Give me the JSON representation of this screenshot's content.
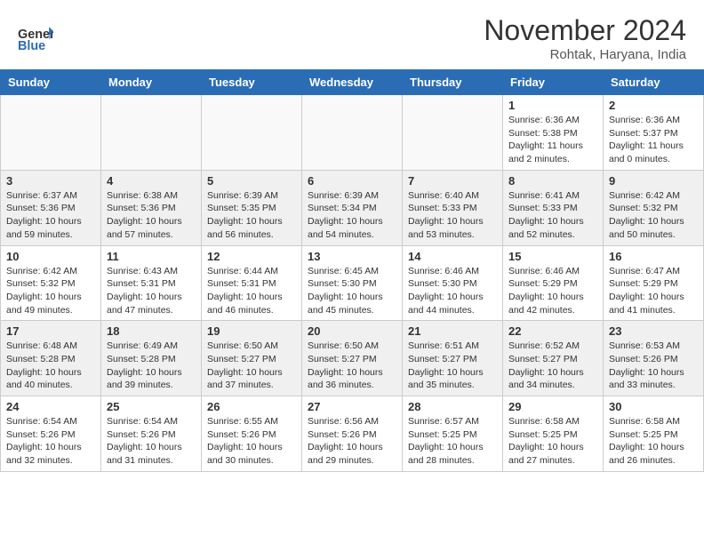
{
  "header": {
    "logo_general": "General",
    "logo_blue": "Blue",
    "month_title": "November 2024",
    "location": "Rohtak, Haryana, India"
  },
  "weekdays": [
    "Sunday",
    "Monday",
    "Tuesday",
    "Wednesday",
    "Thursday",
    "Friday",
    "Saturday"
  ],
  "rows": [
    {
      "shaded": false,
      "days": [
        {
          "num": "",
          "empty": true
        },
        {
          "num": "",
          "empty": true
        },
        {
          "num": "",
          "empty": true
        },
        {
          "num": "",
          "empty": true
        },
        {
          "num": "",
          "empty": true
        },
        {
          "num": "1",
          "sunrise": "6:36 AM",
          "sunset": "5:38 PM",
          "daylight": "11 hours and 2 minutes."
        },
        {
          "num": "2",
          "sunrise": "6:36 AM",
          "sunset": "5:37 PM",
          "daylight": "11 hours and 0 minutes."
        }
      ]
    },
    {
      "shaded": true,
      "days": [
        {
          "num": "3",
          "sunrise": "6:37 AM",
          "sunset": "5:36 PM",
          "daylight": "10 hours and 59 minutes."
        },
        {
          "num": "4",
          "sunrise": "6:38 AM",
          "sunset": "5:36 PM",
          "daylight": "10 hours and 57 minutes."
        },
        {
          "num": "5",
          "sunrise": "6:39 AM",
          "sunset": "5:35 PM",
          "daylight": "10 hours and 56 minutes."
        },
        {
          "num": "6",
          "sunrise": "6:39 AM",
          "sunset": "5:34 PM",
          "daylight": "10 hours and 54 minutes."
        },
        {
          "num": "7",
          "sunrise": "6:40 AM",
          "sunset": "5:33 PM",
          "daylight": "10 hours and 53 minutes."
        },
        {
          "num": "8",
          "sunrise": "6:41 AM",
          "sunset": "5:33 PM",
          "daylight": "10 hours and 52 minutes."
        },
        {
          "num": "9",
          "sunrise": "6:42 AM",
          "sunset": "5:32 PM",
          "daylight": "10 hours and 50 minutes."
        }
      ]
    },
    {
      "shaded": false,
      "days": [
        {
          "num": "10",
          "sunrise": "6:42 AM",
          "sunset": "5:32 PM",
          "daylight": "10 hours and 49 minutes."
        },
        {
          "num": "11",
          "sunrise": "6:43 AM",
          "sunset": "5:31 PM",
          "daylight": "10 hours and 47 minutes."
        },
        {
          "num": "12",
          "sunrise": "6:44 AM",
          "sunset": "5:31 PM",
          "daylight": "10 hours and 46 minutes."
        },
        {
          "num": "13",
          "sunrise": "6:45 AM",
          "sunset": "5:30 PM",
          "daylight": "10 hours and 45 minutes."
        },
        {
          "num": "14",
          "sunrise": "6:46 AM",
          "sunset": "5:30 PM",
          "daylight": "10 hours and 44 minutes."
        },
        {
          "num": "15",
          "sunrise": "6:46 AM",
          "sunset": "5:29 PM",
          "daylight": "10 hours and 42 minutes."
        },
        {
          "num": "16",
          "sunrise": "6:47 AM",
          "sunset": "5:29 PM",
          "daylight": "10 hours and 41 minutes."
        }
      ]
    },
    {
      "shaded": true,
      "days": [
        {
          "num": "17",
          "sunrise": "6:48 AM",
          "sunset": "5:28 PM",
          "daylight": "10 hours and 40 minutes."
        },
        {
          "num": "18",
          "sunrise": "6:49 AM",
          "sunset": "5:28 PM",
          "daylight": "10 hours and 39 minutes."
        },
        {
          "num": "19",
          "sunrise": "6:50 AM",
          "sunset": "5:27 PM",
          "daylight": "10 hours and 37 minutes."
        },
        {
          "num": "20",
          "sunrise": "6:50 AM",
          "sunset": "5:27 PM",
          "daylight": "10 hours and 36 minutes."
        },
        {
          "num": "21",
          "sunrise": "6:51 AM",
          "sunset": "5:27 PM",
          "daylight": "10 hours and 35 minutes."
        },
        {
          "num": "22",
          "sunrise": "6:52 AM",
          "sunset": "5:27 PM",
          "daylight": "10 hours and 34 minutes."
        },
        {
          "num": "23",
          "sunrise": "6:53 AM",
          "sunset": "5:26 PM",
          "daylight": "10 hours and 33 minutes."
        }
      ]
    },
    {
      "shaded": false,
      "days": [
        {
          "num": "24",
          "sunrise": "6:54 AM",
          "sunset": "5:26 PM",
          "daylight": "10 hours and 32 minutes."
        },
        {
          "num": "25",
          "sunrise": "6:54 AM",
          "sunset": "5:26 PM",
          "daylight": "10 hours and 31 minutes."
        },
        {
          "num": "26",
          "sunrise": "6:55 AM",
          "sunset": "5:26 PM",
          "daylight": "10 hours and 30 minutes."
        },
        {
          "num": "27",
          "sunrise": "6:56 AM",
          "sunset": "5:26 PM",
          "daylight": "10 hours and 29 minutes."
        },
        {
          "num": "28",
          "sunrise": "6:57 AM",
          "sunset": "5:25 PM",
          "daylight": "10 hours and 28 minutes."
        },
        {
          "num": "29",
          "sunrise": "6:58 AM",
          "sunset": "5:25 PM",
          "daylight": "10 hours and 27 minutes."
        },
        {
          "num": "30",
          "sunrise": "6:58 AM",
          "sunset": "5:25 PM",
          "daylight": "10 hours and 26 minutes."
        }
      ]
    }
  ],
  "labels": {
    "sunrise": "Sunrise:",
    "sunset": "Sunset:",
    "daylight": "Daylight:"
  }
}
